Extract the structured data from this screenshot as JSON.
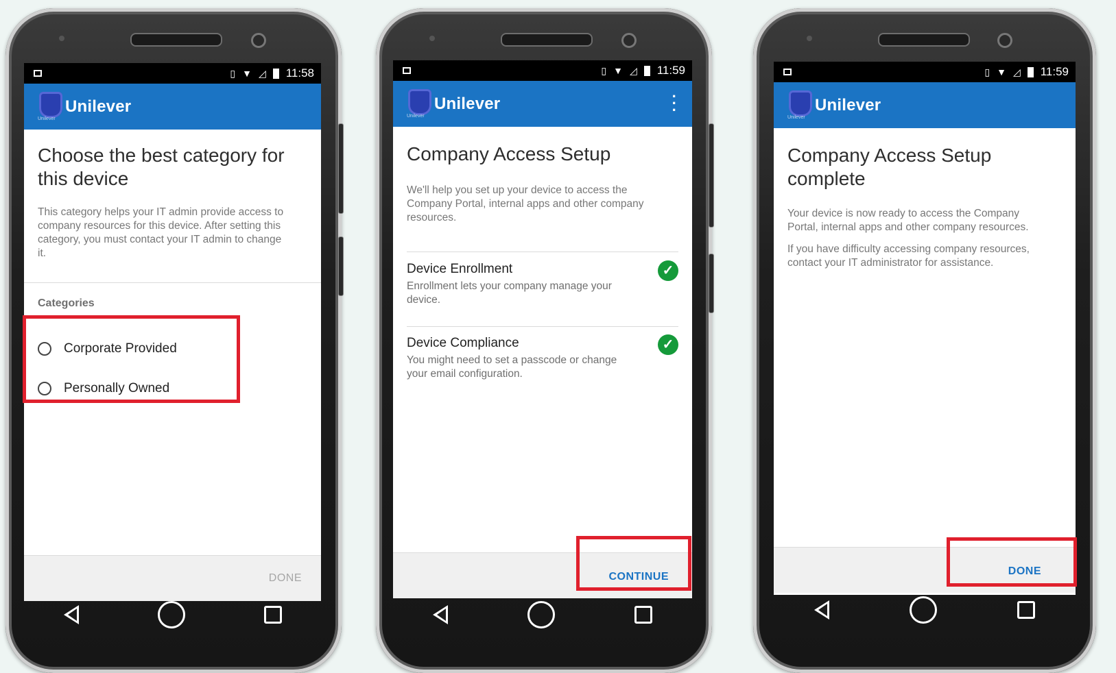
{
  "colors": {
    "accent": "#1b74c4",
    "highlight": "#e0202d",
    "check": "#159a3a",
    "button_active": "#1b74c4",
    "button_disabled": "#a6a6a6"
  },
  "screens": [
    {
      "status": {
        "time": "11:58"
      },
      "appbar": {
        "brand": "Unilever",
        "logo_sub": "Unilever"
      },
      "title_line1": "Choose the best category for",
      "title_line2": "this device",
      "description_lines": [
        "This category helps your IT admin provide access to",
        "company resources for this device. After setting this",
        "category, you must contact your IT admin to change",
        "it."
      ],
      "categories_label": "Categories",
      "options": [
        "Corporate Provided",
        "Personally Owned"
      ],
      "footer_button": "DONE"
    },
    {
      "status": {
        "time": "11:59"
      },
      "appbar": {
        "brand": "Unilever",
        "logo_sub": "Unilever",
        "menu_icon": "more-vert-icon"
      },
      "title": "Company Access Setup",
      "description_lines": [
        "We'll help you set up your device to access the",
        "Company Portal, internal apps and other company",
        "resources."
      ],
      "items": [
        {
          "title": "Device Enrollment",
          "desc_lines": [
            "Enrollment lets your company manage your",
            "device."
          ],
          "status_icon": "check-circle-icon"
        },
        {
          "title": "Device Compliance",
          "desc_lines": [
            "You might need to set a passcode or change",
            "your email configuration."
          ],
          "status_icon": "check-circle-icon"
        }
      ],
      "footer_button": "CONTINUE"
    },
    {
      "status": {
        "time": "11:59"
      },
      "appbar": {
        "brand": "Unilever",
        "logo_sub": "Unilever"
      },
      "title_line1": "Company Access Setup",
      "title_line2": "complete",
      "paragraph1_lines": [
        "Your device is now ready to access the Company",
        "Portal, internal apps and other company resources."
      ],
      "paragraph2_lines": [
        "If you have difficulty accessing company resources,",
        "contact your IT administrator for assistance."
      ],
      "footer_button": "DONE"
    }
  ]
}
